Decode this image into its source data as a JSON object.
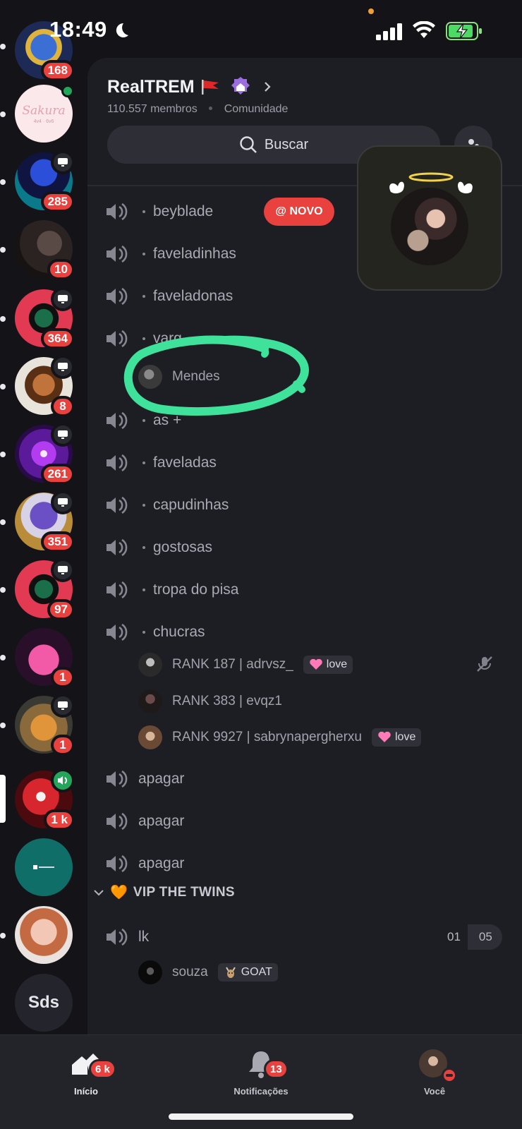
{
  "status": {
    "time": "18:49"
  },
  "colors": {
    "accent": "#e9413e",
    "online": "#23a55a",
    "highlight": "#3ee29a",
    "panel": "#1d1e24"
  },
  "rail": {
    "servers": [
      {
        "badge": "168",
        "icon": "rabbit-server-icon"
      },
      {
        "label": "Sakura",
        "sub": "4v4 · 6v6",
        "icon": "sakura-server-icon"
      },
      {
        "badge": "285",
        "icon": "nexus-server-icon"
      },
      {
        "badge": "10",
        "icon": "dark-server-icon"
      },
      {
        "badge": "364",
        "icon": "mora-server-icon"
      },
      {
        "badge": "8",
        "icon": "monkey-server-icon"
      },
      {
        "badge": "261",
        "icon": "purple-eye-server-icon"
      },
      {
        "badge": "351",
        "icon": "gengar-server-icon"
      },
      {
        "badge": "97",
        "icon": "mora-server-icon"
      },
      {
        "badge": "1",
        "icon": "drg-server-icon"
      },
      {
        "badge": "1",
        "icon": "cat-server-icon"
      },
      {
        "badge": "1 k",
        "icon": "red-server-icon"
      },
      {
        "icon": "teal-server-icon"
      },
      {
        "icon": "portrait-server-icon"
      },
      {
        "label": "Sds"
      }
    ]
  },
  "guild": {
    "name": "RealTREM",
    "members": "110.557 membros",
    "type": "Comunidade",
    "search_label": "Buscar"
  },
  "new_badge": "@ NOVO",
  "channels": [
    {
      "name": "beyblade"
    },
    {
      "name": "faveladinhas"
    },
    {
      "name": "faveladonas"
    },
    {
      "name": "varg"
    },
    {
      "name": "as +"
    },
    {
      "name": "faveladas"
    },
    {
      "name": "capudinhas"
    },
    {
      "name": "gostosas"
    },
    {
      "name": "tropa do pisa"
    },
    {
      "name": "chucras"
    },
    {
      "name": "apagar"
    },
    {
      "name": "apagar"
    },
    {
      "name": "apagar"
    },
    {
      "name": "lk"
    }
  ],
  "members": {
    "varg": [
      {
        "name": "Mendes"
      }
    ],
    "chucras": [
      {
        "name": "RANK 187 | adrvsz_",
        "tag": "love"
      },
      {
        "name": "RANK 383 | evqz1"
      },
      {
        "name": "RANK 9927 | sabrynapergherxu",
        "tag": "love"
      }
    ],
    "lk": [
      {
        "name": "souza",
        "tag": "GOAT"
      }
    ]
  },
  "category": {
    "name": "VIP THE TWINS",
    "emoji": "🧡"
  },
  "lk_counter": {
    "current": "01",
    "limit": "05"
  },
  "nav": {
    "home": {
      "label": "Início",
      "badge": "6 k"
    },
    "notifications": {
      "label": "Notificações",
      "badge": "13"
    },
    "you": {
      "label": "Você"
    }
  }
}
